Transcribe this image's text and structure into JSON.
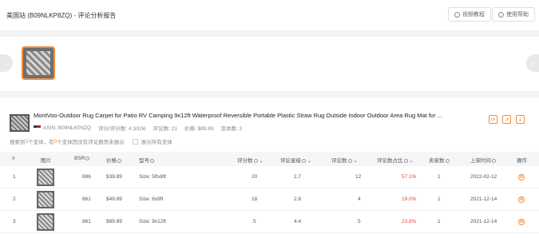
{
  "header": {
    "title": "美国站 (B09NLKP8ZQ) - 评论分析报告",
    "video_btn": "视频教程",
    "help_btn": "使用帮助"
  },
  "product": {
    "title": "MontVoo-Outdoor Rug Carpet for Patio RV Camping 9x12ft Waterproof Reversible Portable Plastic Straw Rug Outside Indoor Outdoor Area Rug Mat for ...",
    "asin": "ASIN: B09NLKP8ZQ",
    "score": "评分/评分数: 4.3/106",
    "reviews": "评论数: 21",
    "price": "价格: $89.89",
    "variants": "变体数: 3"
  },
  "summary": {
    "prefix": "搜索到",
    "count": "3",
    "mid": "个变体，有",
    "zero": "0",
    "suffix": "个变体因没有评论数而未展示",
    "show_all": "展示所有变体"
  },
  "table": {
    "headers": {
      "index": "#",
      "image": "图片",
      "bsr": "BSR",
      "price": "价格",
      "model": "型号",
      "rating_count": "评分数",
      "stars": "评论星级",
      "review_count": "评论数",
      "ratio": "评论数占比",
      "sellers": "卖家数",
      "date": "上架时间",
      "ops": "操作"
    },
    "rows": [
      {
        "index": "1",
        "bsr": "886",
        "price": "$39.89",
        "model": "Size: 5ftx8ft",
        "rating_count": "20",
        "stars": "2.7",
        "review_count": "12",
        "ratio": "57.1%",
        "sellers": "1",
        "date": "2022-02-12"
      },
      {
        "index": "2",
        "bsr": "861",
        "price": "$49.89",
        "model": "Size: 6x9ft",
        "rating_count": "18",
        "stars": "2.8",
        "review_count": "4",
        "ratio": "19.0%",
        "sellers": "1",
        "date": "2021-12-14"
      },
      {
        "index": "3",
        "bsr": "861",
        "price": "$89.89",
        "model": "Size: 9x12ft",
        "rating_count": "5",
        "stars": "4.4",
        "review_count": "5",
        "ratio": "23.8%",
        "sellers": "1",
        "date": "2021-12-14"
      }
    ]
  },
  "colors": {
    "accent": "#f08c3c",
    "ratio": "#e54545"
  }
}
